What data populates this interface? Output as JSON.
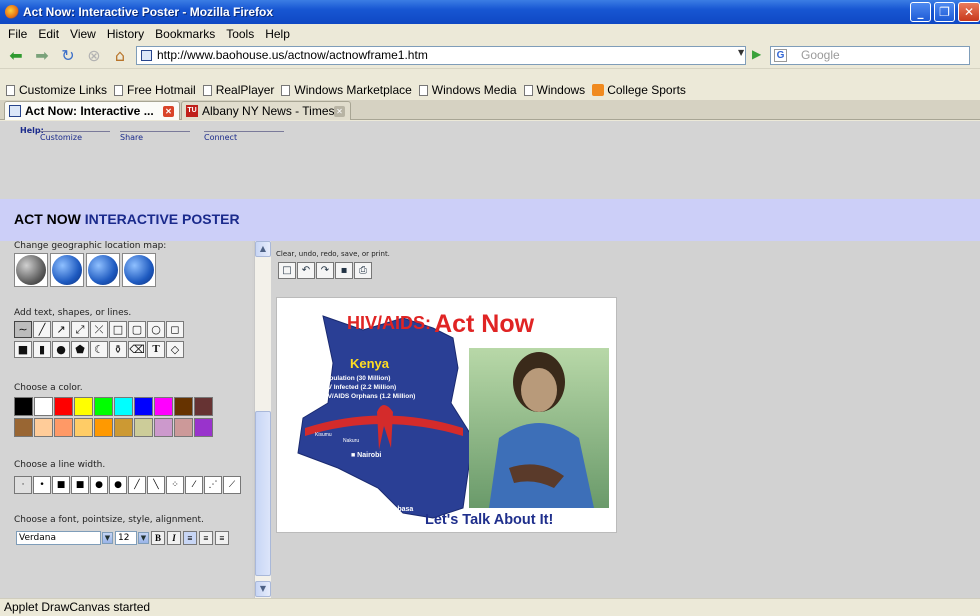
{
  "window": {
    "title": "Act Now: Interactive Poster - Mozilla Firefox"
  },
  "menu": [
    "File",
    "Edit",
    "View",
    "History",
    "Bookmarks",
    "Tools",
    "Help"
  ],
  "nav": {
    "url": "http://www.baohouse.us/actnow/actnowframe1.htm",
    "search_placeholder": "Google"
  },
  "bookmarks": [
    "Customize Links",
    "Free Hotmail",
    "RealPlayer",
    "Windows Marketplace",
    "Windows Media",
    "Windows",
    "College Sports"
  ],
  "tabs": [
    {
      "label": "Act Now: Interactive ...",
      "active": true
    },
    {
      "label": "Albany NY News - Times...",
      "active": false
    }
  ],
  "page": {
    "help": {
      "label": "Help:",
      "links": [
        "Customize",
        "Share",
        "Connect"
      ]
    },
    "banner": {
      "title_a": "ACT NOW",
      "title_b": "INTERACTIVE POSTER"
    },
    "left_panel": {
      "geo_label": "Change geographic location map:",
      "shapes_label": "Add text, shapes, or lines.",
      "color_label": "Choose a color.",
      "colors": [
        "#000000",
        "#ffffff",
        "#ff0000",
        "#ffff00",
        "#00ff00",
        "#00ffff",
        "#0000ff",
        "#ff00ff",
        "#663300",
        "#663333",
        "#996633",
        "#ffcc99",
        "#ff9966",
        "#ffcc66",
        "#ff9900",
        "#cc9933",
        "#cccc99",
        "#cc99cc",
        "#cc9999",
        "#9933cc"
      ],
      "width_label": "Choose a line width.",
      "font_label": "Choose a font, pointsize, style, alignment.",
      "font_value": "Verdana",
      "size_value": "12",
      "style_bold": "B",
      "style_italic": "I"
    },
    "canvas": {
      "label": "Clear, undo, redo, save, or print.",
      "poster": {
        "headline_a": "HIV/AIDS:",
        "headline_b": "Act Now",
        "country": "Kenya",
        "stats": [
          "• Population (30 Million)",
          "• HIV Infected (2.2 Million)",
          "• HIV/AIDS Orphans (1.2 Million)"
        ],
        "cities": [
          "Kisumu",
          "Nakuru",
          "■ Nairobi",
          "Mombasa"
        ],
        "tagline": "Let's Talk About It!"
      }
    }
  },
  "status": "Applet DrawCanvas started"
}
